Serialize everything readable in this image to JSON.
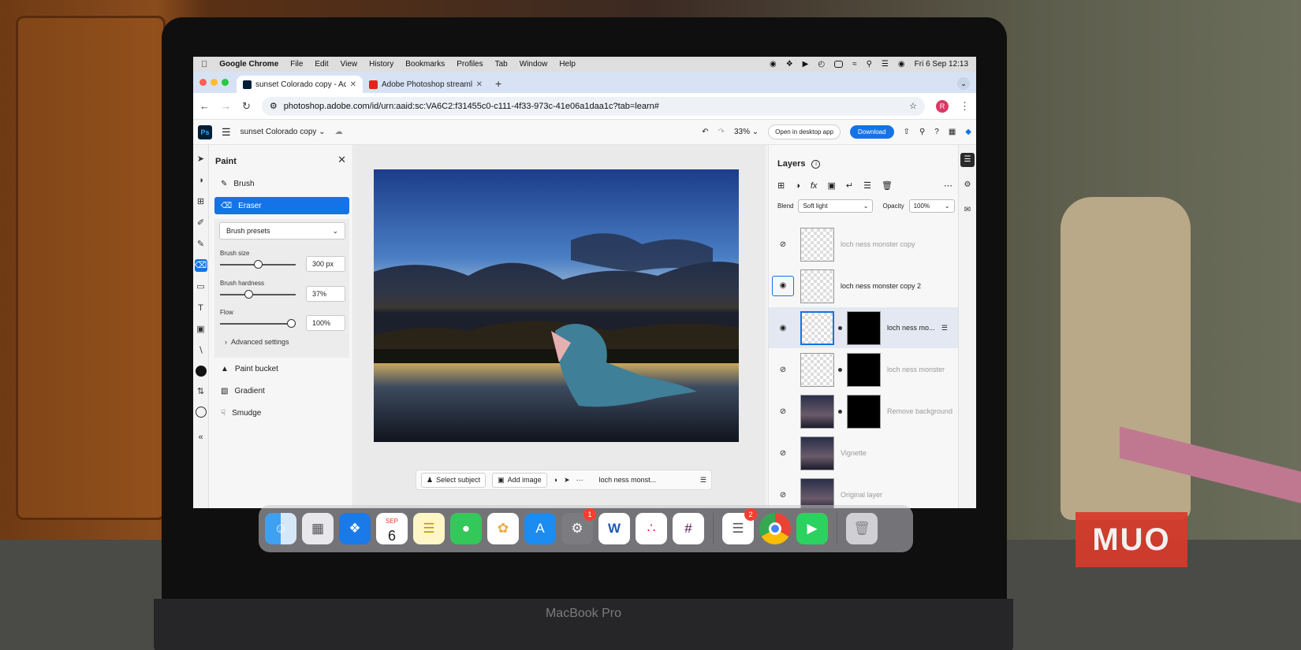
{
  "mac_menubar": {
    "app_name": "Google Chrome",
    "menus": [
      "File",
      "Edit",
      "View",
      "History",
      "Bookmarks",
      "Profiles",
      "Tab",
      "Window",
      "Help"
    ],
    "clock": "Fri 6 Sep  12:13"
  },
  "browser": {
    "tabs": [
      {
        "title": "sunset Colorado copy - Adobe",
        "active": true
      },
      {
        "title": "Adobe Photoshop streamline",
        "active": false
      }
    ],
    "url": "photoshop.adobe.com/id/urn:aaid:sc:VA6C2:f31455c0-c111-4f33-973c-41e06a1daa1c?tab=learn#",
    "profile_initial": "R"
  },
  "ps_header": {
    "logo": "Ps",
    "document_name": "sunset Colorado copy",
    "zoom": "33%",
    "open_desktop_label": "Open in desktop app",
    "download_label": "Download"
  },
  "paint_panel": {
    "title": "Paint",
    "tools_top": [
      "Brush",
      "Eraser"
    ],
    "presets_label": "Brush presets",
    "sliders": [
      {
        "label": "Brush size",
        "value": "300 px",
        "fraction": 0.5
      },
      {
        "label": "Brush hardness",
        "value": "37%",
        "fraction": 0.37
      },
      {
        "label": "Flow",
        "value": "100%",
        "fraction": 1.0
      }
    ],
    "advanced_label": "Advanced settings",
    "tools_bottom": [
      "Paint bucket",
      "Gradient",
      "Smudge"
    ]
  },
  "taskbar": {
    "select_subject": "Select subject",
    "add_image": "Add image",
    "layer_name": "loch ness monst..."
  },
  "layers_panel": {
    "title": "Layers",
    "blend_label": "Blend",
    "blend_mode": "Soft light",
    "opacity_label": "Opacity",
    "opacity_value": "100%",
    "layers": [
      {
        "name": "loch ness monster copy"
      },
      {
        "name": "loch ness monster copy 2"
      },
      {
        "name": "loch ness mo..."
      },
      {
        "name": "loch ness monster"
      },
      {
        "name": "Remove background"
      },
      {
        "name": "Vignette"
      },
      {
        "name": "Original layer"
      }
    ]
  },
  "dock": {
    "calendar_month": "SEP",
    "calendar_day": "6",
    "badges": {
      "settings": "1",
      "reminders": "2"
    }
  },
  "laptop_label": "MacBook Pro",
  "watermark": "MUO"
}
